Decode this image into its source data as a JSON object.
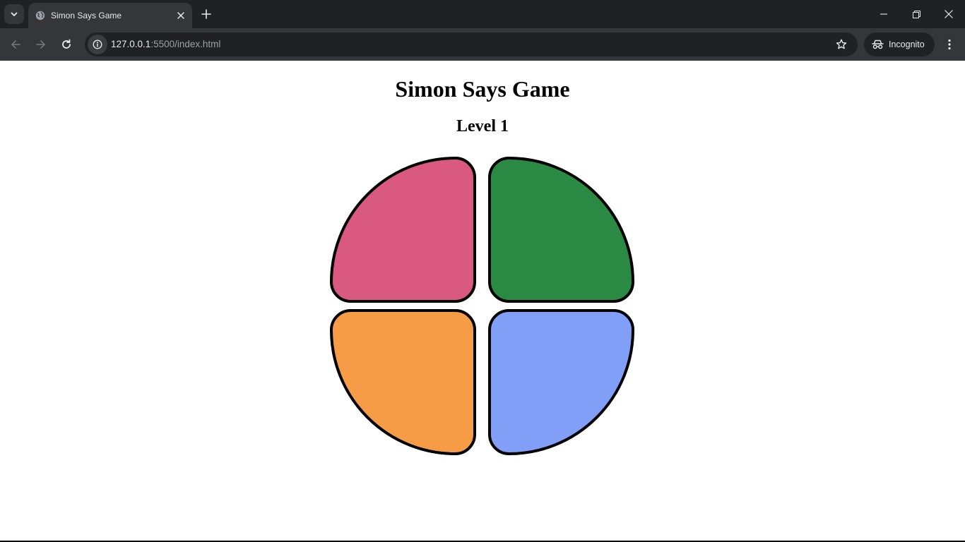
{
  "browser": {
    "tab": {
      "title": "Simon Says Game",
      "favicon": "globe-icon"
    },
    "address_bar": {
      "host": "127.0.0.1",
      "path": ":5500/index.html"
    },
    "profile_label": "Incognito",
    "icons": {
      "tab_search": "chevron-down-icon",
      "tab_close": "close-icon",
      "new_tab": "plus-icon",
      "back": "arrow-left-icon",
      "forward": "arrow-right-icon",
      "reload": "reload-icon",
      "site_info": "info-icon",
      "bookmark": "star-icon",
      "menu": "kebab-menu-icon"
    }
  },
  "game": {
    "title": "Simon Says Game",
    "level_text": "Level 1",
    "buttons": [
      {
        "id": "pink",
        "color": "#d95980"
      },
      {
        "id": "green",
        "color": "#2a8a43"
      },
      {
        "id": "orange",
        "color": "#f79c46"
      },
      {
        "id": "blue",
        "color": "#829ff7"
      }
    ]
  }
}
